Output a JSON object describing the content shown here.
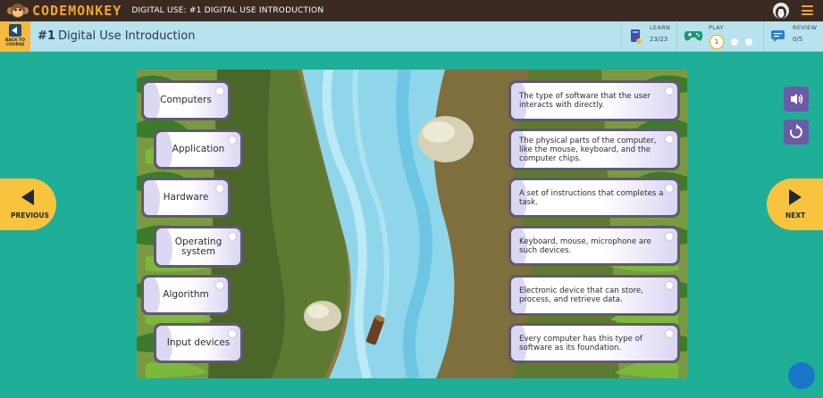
{
  "app": {
    "brand": "CODEMONKEY",
    "page_title": "DIGITAL USE: #1 DIGITAL USE INTRODUCTION"
  },
  "header": {
    "back_label": "BACK TO COURSE",
    "lesson_number": "#1",
    "lesson_title": "Digital Use Introduction",
    "learn": {
      "label": "LEARN",
      "value": "23/23"
    },
    "play": {
      "label": "PLAY",
      "current": "1"
    },
    "review": {
      "label": "REVIEW",
      "value": "0/5"
    }
  },
  "nav": {
    "previous": "PREVIOUS",
    "next": "NEXT"
  },
  "terms": [
    "Computers",
    "Application",
    "Hardware",
    "Operating system",
    "Algorithm",
    "Input devices"
  ],
  "definitions": [
    "The type of software that the user interacts with directly.",
    "The physical parts of the computer, like the mouse, keyboard, and the computer chips.",
    "A set of instructions that completes a task.",
    "Keyboard, mouse, microphone are such devices.",
    "Electronic device that can store, process, and retrieve data.",
    "Every computer has this type of software as its foundation."
  ],
  "colors": {
    "background": "#1fae97",
    "topbar": "#3a2a22",
    "header": "#b8e2ee",
    "accent": "#f9c33e",
    "purple_button": "#6b5aa8",
    "card_border": "#5f5a6e",
    "river": "#7fd0e6"
  },
  "icons": {
    "back": "back-arrow-icon",
    "learn": "book-icon",
    "play": "gamepad-icon",
    "review": "chat-icon",
    "sound": "speaker-icon",
    "reset": "reset-icon",
    "menu": "hamburger-icon"
  }
}
